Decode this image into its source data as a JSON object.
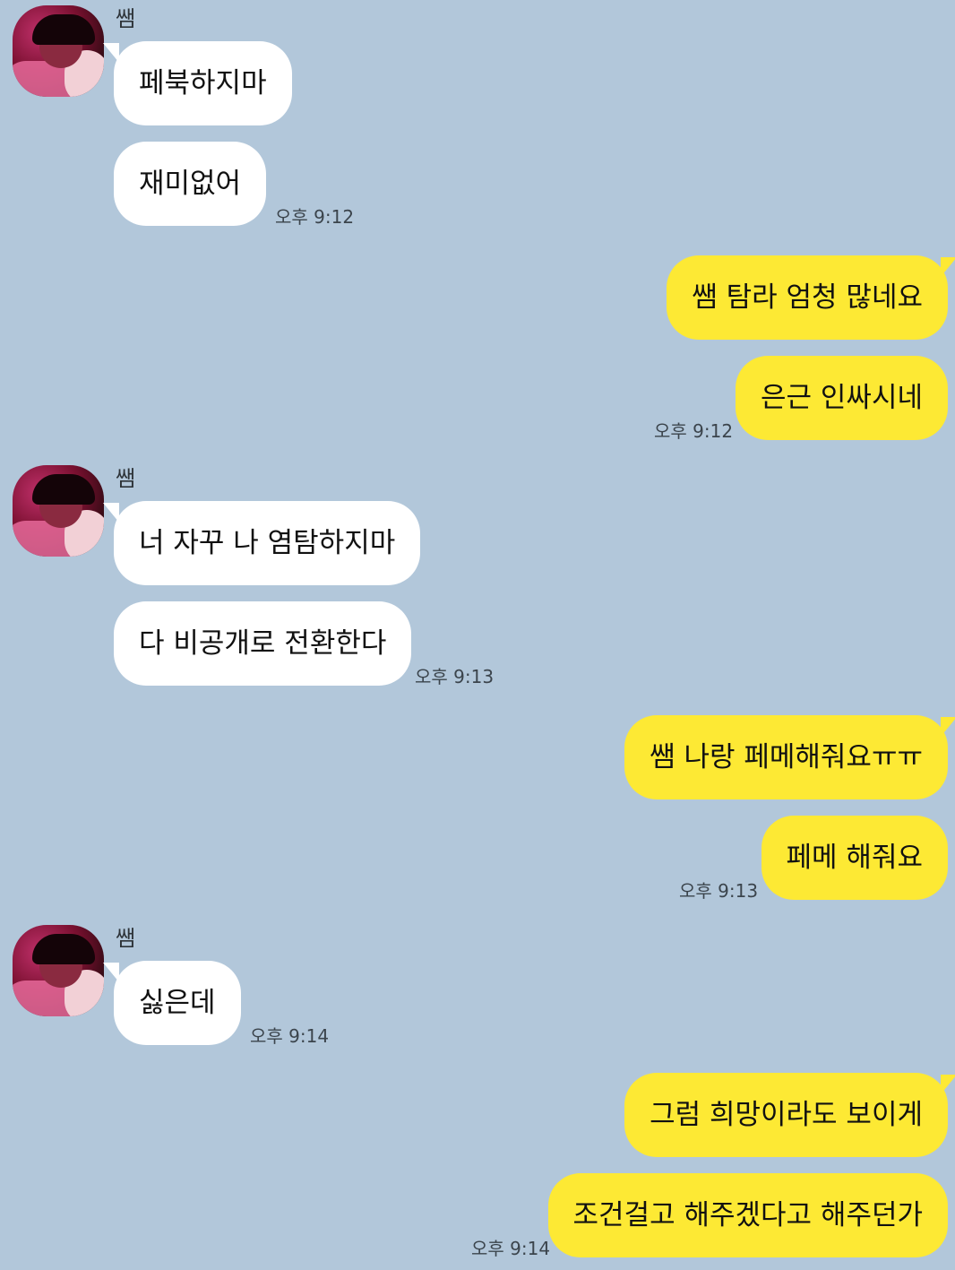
{
  "chat": {
    "sender_name": "쌤",
    "blocks": [
      {
        "from": "them",
        "sender": "쌤",
        "messages": [
          "페북하지마",
          "재미없어"
        ],
        "time": "오후 9:12"
      },
      {
        "from": "me",
        "messages": [
          "쌤 탐라 엄청 많네요",
          "은근 인싸시네"
        ],
        "time": "오후 9:12"
      },
      {
        "from": "them",
        "sender": "쌤",
        "messages": [
          "너 자꾸 나 염탐하지마",
          "다 비공개로 전환한다"
        ],
        "time": "오후 9:13"
      },
      {
        "from": "me",
        "messages": [
          "쌤 나랑 페메해줘요ㅠㅠ",
          "페메 해줘요"
        ],
        "time": "오후 9:13"
      },
      {
        "from": "them",
        "sender": "쌤",
        "messages": [
          "싫은데"
        ],
        "time": "오후 9:14"
      },
      {
        "from": "me",
        "messages": [
          "그럼 희망이라도 보이게",
          "조건걸고 해주겠다고 해주던가"
        ],
        "time": "오후 9:14"
      }
    ]
  },
  "colors": {
    "background": "#b2c7da",
    "incoming_bubble": "#ffffff",
    "outgoing_bubble": "#fde934"
  }
}
